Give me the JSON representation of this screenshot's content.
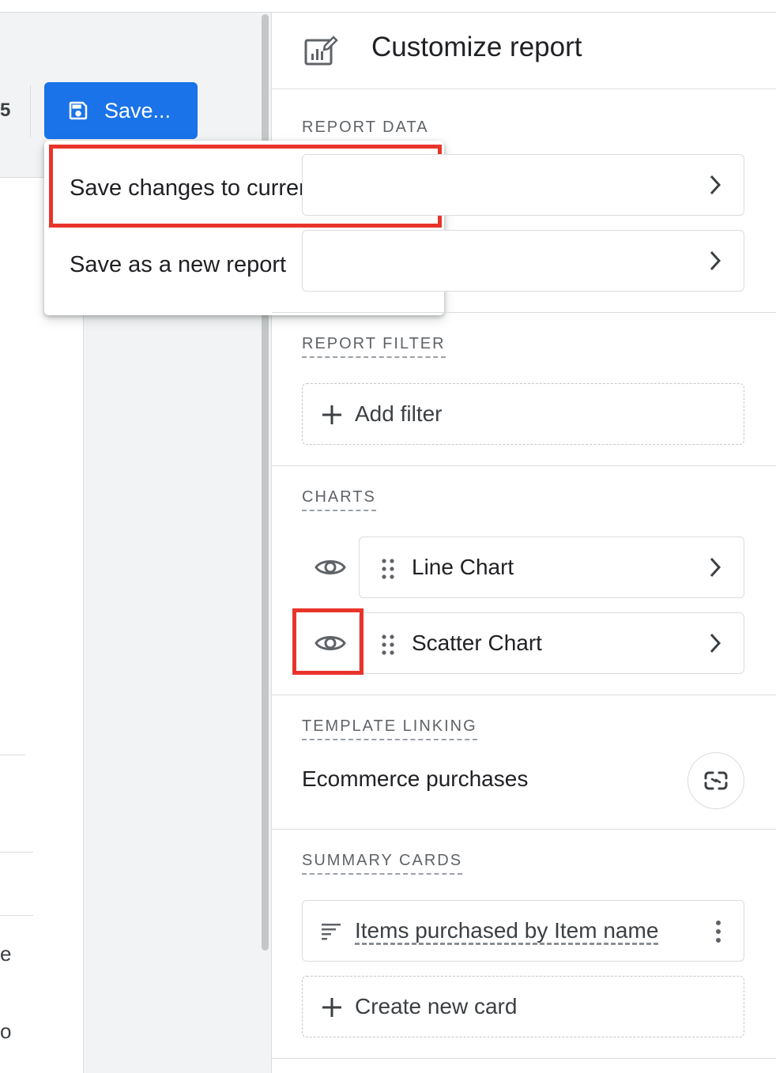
{
  "toolbar": {
    "partial_left_text": "5",
    "save_label": "Save...",
    "save_icon": "floppy-disk-icon"
  },
  "save_menu": {
    "items": [
      {
        "label": "Save changes to current report",
        "highlighted": true
      },
      {
        "label": "Save as a new report",
        "highlighted": false
      }
    ]
  },
  "left_partial": {
    "text_e": "e",
    "text_o": "o"
  },
  "panel": {
    "title": "Customize report",
    "title_icon": "edit-chart-icon",
    "report_data": {
      "label": "REPORT DATA",
      "items": [
        "",
        ""
      ]
    },
    "report_filter": {
      "label": "REPORT FILTER",
      "add_filter": "Add filter"
    },
    "charts": {
      "label": "CHARTS",
      "items": [
        {
          "name": "Line Chart",
          "visible": true,
          "highlighted": false
        },
        {
          "name": "Scatter Chart",
          "visible": true,
          "highlighted": true
        }
      ]
    },
    "template_linking": {
      "label": "TEMPLATE LINKING",
      "template_name": "Ecommerce purchases",
      "link_icon": "unlink-icon"
    },
    "summary_cards": {
      "label": "SUMMARY CARDS",
      "items": [
        {
          "name": "Items purchased by Item name"
        }
      ],
      "create_label": "Create new card"
    }
  },
  "colors": {
    "primary": "#1a73e8",
    "highlight": "#e8342a"
  }
}
